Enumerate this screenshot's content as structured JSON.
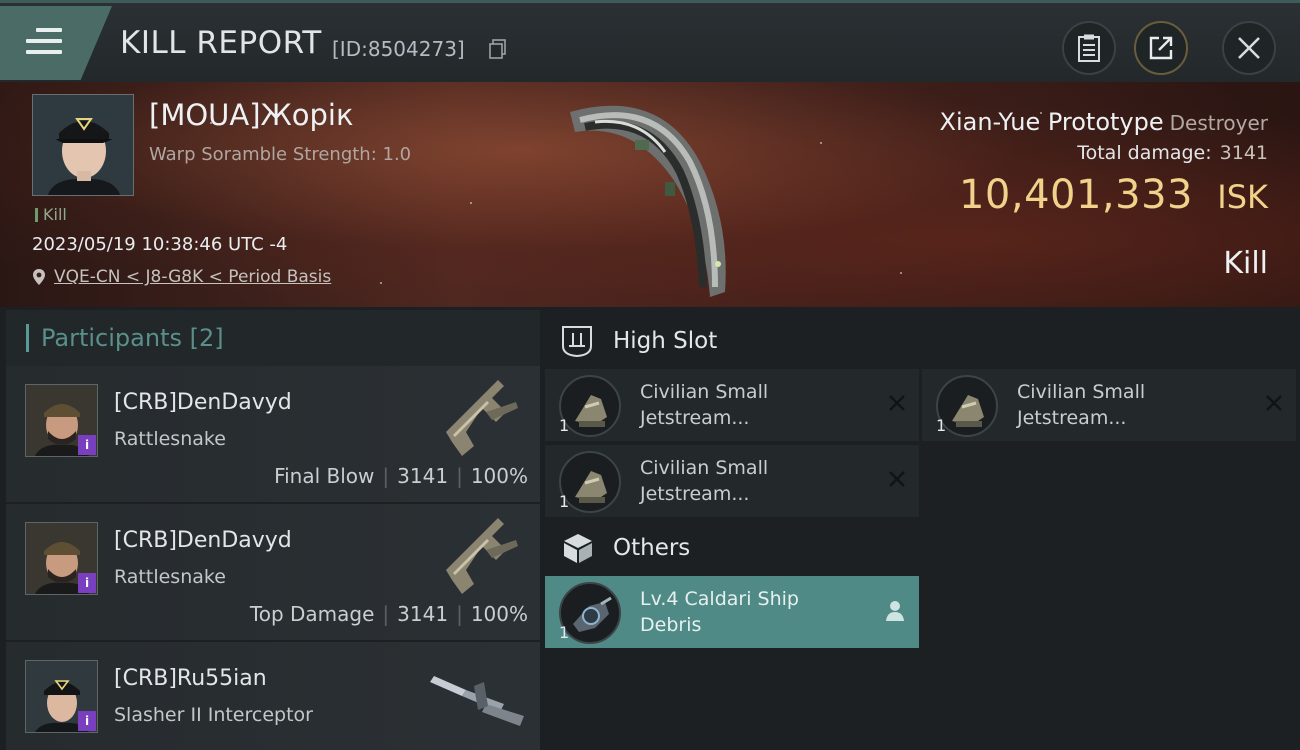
{
  "header": {
    "title": "KILL REPORT",
    "report_id": "[ID:8504273]"
  },
  "victim": {
    "name": "[MOUA]Жорік",
    "detail": "Warp Soramble Strength: 1.0",
    "tag": "Kill",
    "datetime": "2023/05/19 10:38:46 UTC -4",
    "location": "VQE-CN < J8-G8K < Period Basis",
    "ship_name": "Xian-Yue Prototype",
    "ship_class": "Destroyer",
    "total_damage_label": "Total damage:",
    "total_damage": "3141",
    "isk_value": "10,401,333",
    "isk_label": "ISK",
    "result": "Kill"
  },
  "participants": {
    "label": "Participants",
    "count": "[2]",
    "rows": [
      {
        "name": "[CRB]DenDavyd",
        "ship": "Rattlesnake",
        "role": "Final Blow",
        "damage": "3141",
        "percent": "100%"
      },
      {
        "name": "[CRB]DenDavyd",
        "ship": "Rattlesnake",
        "role": "Top Damage",
        "damage": "3141",
        "percent": "100%"
      },
      {
        "name": "[CRB]Ru55ian",
        "ship": "Slasher II Interceptor"
      }
    ]
  },
  "high_slot": {
    "label": "High Slot",
    "items": [
      {
        "qty": "1",
        "name_line1": "Civilian Small",
        "name_line2": "Jetstream..."
      },
      {
        "qty": "1",
        "name_line1": "Civilian Small",
        "name_line2": "Jetstream..."
      },
      {
        "qty": "1",
        "name_line1": "Civilian Small",
        "name_line2": "Jetstream..."
      }
    ]
  },
  "others": {
    "label": "Others",
    "items": [
      {
        "qty": "1",
        "name_line1": "Lv.4 Caldari Ship",
        "name_line2": "Debris"
      }
    ]
  },
  "colors": {
    "accent": "#4f8a86",
    "isk": "#f0d28a",
    "badge": "#7a3fbf"
  }
}
